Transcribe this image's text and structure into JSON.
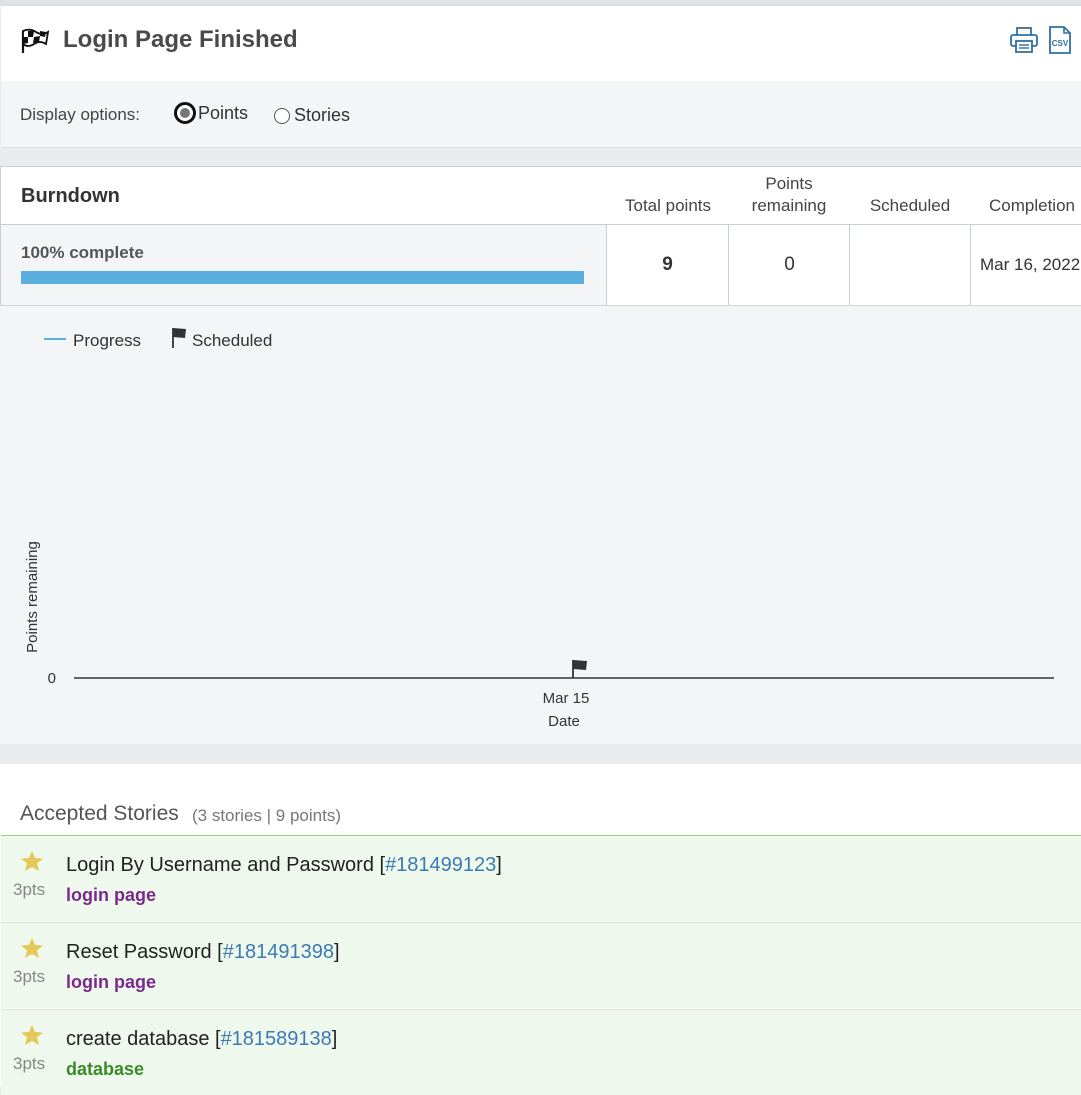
{
  "header": {
    "title": "Login Page Finished",
    "icons": [
      "checkered-flag-icon",
      "printer-icon",
      "csv-file-icon"
    ]
  },
  "display_options": {
    "label": "Display options:",
    "options": [
      {
        "label": "Points",
        "selected": true
      },
      {
        "label": "Stories",
        "selected": false
      }
    ]
  },
  "burndown": {
    "title": "Burndown",
    "columns": {
      "total_points": "Total points",
      "points_remaining_line1": "Points",
      "points_remaining_line2": "remaining",
      "scheduled": "Scheduled",
      "completion": "Completion"
    },
    "complete_text": "100% complete",
    "progress_fraction": 1.0,
    "total_points": "9",
    "points_remaining": "0",
    "scheduled": "",
    "completion": "Mar 16, 2022",
    "progress_color": "#5aafdf"
  },
  "chart_data": {
    "type": "line",
    "title": "",
    "xlabel": "Date",
    "ylabel": "Points remaining",
    "legend": [
      {
        "name": "Progress",
        "color": "#5aafdf",
        "marker": "line"
      },
      {
        "name": "Scheduled",
        "color": "#333333",
        "marker": "flag"
      }
    ],
    "legend_placement": "top-left",
    "x_ticks": [
      "Mar 15"
    ],
    "y_ticks": [
      0
    ],
    "series": [],
    "scheduled_markers": [
      {
        "x": "Mar 15",
        "y": 0
      }
    ]
  },
  "accepted": {
    "title": "Accepted Stories",
    "summary": "(3 stories | 9 points)",
    "stories": [
      {
        "name": "Login By Username and Password [",
        "id": "#181499123",
        "close": "]",
        "points": "3pts",
        "label": "login page",
        "label_color": "#7a2a8c"
      },
      {
        "name": "Reset Password [",
        "id": "#181491398",
        "close": "]",
        "points": "3pts",
        "label": "login page",
        "label_color": "#7a2a8c"
      },
      {
        "name": "create database [",
        "id": "#181589138",
        "close": "]",
        "points": "3pts",
        "label": "database",
        "label_color": "#3c8b2a"
      }
    ]
  }
}
